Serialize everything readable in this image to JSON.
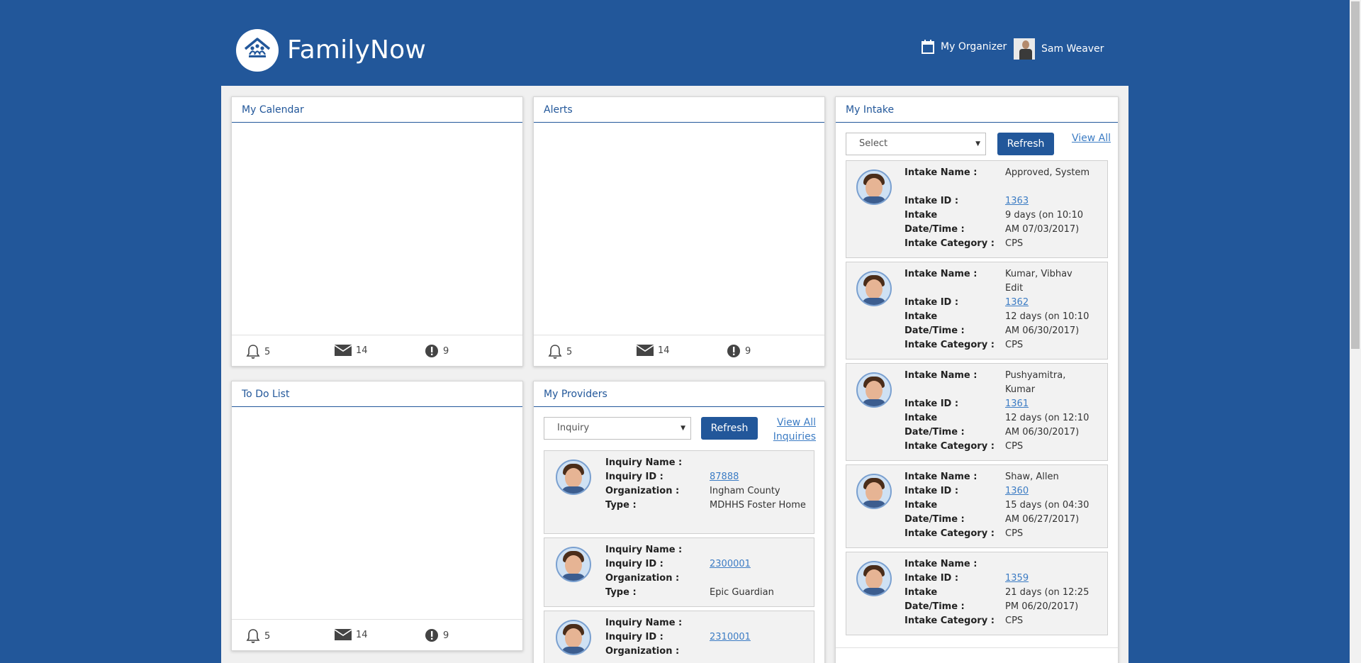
{
  "header": {
    "brand": "FamilyNow",
    "organizer": "My Organizer",
    "user": "Sam Weaver"
  },
  "calendar": {
    "title": "My Calendar",
    "footer": {
      "bell": "5",
      "mail": "14",
      "alert": "9"
    }
  },
  "alerts": {
    "title": "Alerts",
    "footer": {
      "bell": "5",
      "mail": "14",
      "alert": "9"
    }
  },
  "todo": {
    "title": "To Do List",
    "footer": {
      "bell": "5",
      "mail": "14",
      "alert": "9"
    }
  },
  "providers": {
    "title": "My Providers",
    "select_value": "Inquiry",
    "refresh": "Refresh",
    "view_all": "View All Inquiries",
    "labels": {
      "name": "Inquiry Name :",
      "id": "Inquiry ID :",
      "org": "Organization :",
      "type": "Type :"
    },
    "items": [
      {
        "name": "",
        "id": "87888",
        "org": "Ingham County MDHHS Foster Home",
        "type": ""
      },
      {
        "name": "",
        "id": "2300001",
        "org": "",
        "type": "Epic Guardian"
      },
      {
        "name": "",
        "id": "2310001",
        "org": "",
        "type": ""
      }
    ]
  },
  "intake": {
    "title": "My Intake",
    "select_value": "Select",
    "refresh": "Refresh",
    "view_all": "View All",
    "labels": {
      "name": "Intake Name :",
      "id": "Intake ID :",
      "date1": "Intake",
      "date2": "Date/Time :",
      "category": "Intake Category :"
    },
    "items": [
      {
        "name": "Approved, System",
        "id": "1363",
        "date": "9 days (on 10:10 AM 07/03/2017)",
        "category": "CPS"
      },
      {
        "name": "Kumar, Vibhav Edit",
        "id": "1362",
        "date": "12 days (on 10:10 AM 06/30/2017)",
        "category": "CPS"
      },
      {
        "name": "Pushyamitra, Kumar",
        "id": "1361",
        "date": "12 days (on 12:10 AM 06/30/2017)",
        "category": "CPS"
      },
      {
        "name": "Shaw, Allen",
        "id": "1360",
        "date": "15 days (on 04:30 AM 06/27/2017)",
        "category": "CPS"
      },
      {
        "name": "",
        "id": "1359",
        "date": "21 days (on 12:25 PM 06/20/2017)",
        "category": "CPS"
      }
    ]
  },
  "colors": {
    "brand": "#22579a",
    "link": "#3c7cc4"
  }
}
